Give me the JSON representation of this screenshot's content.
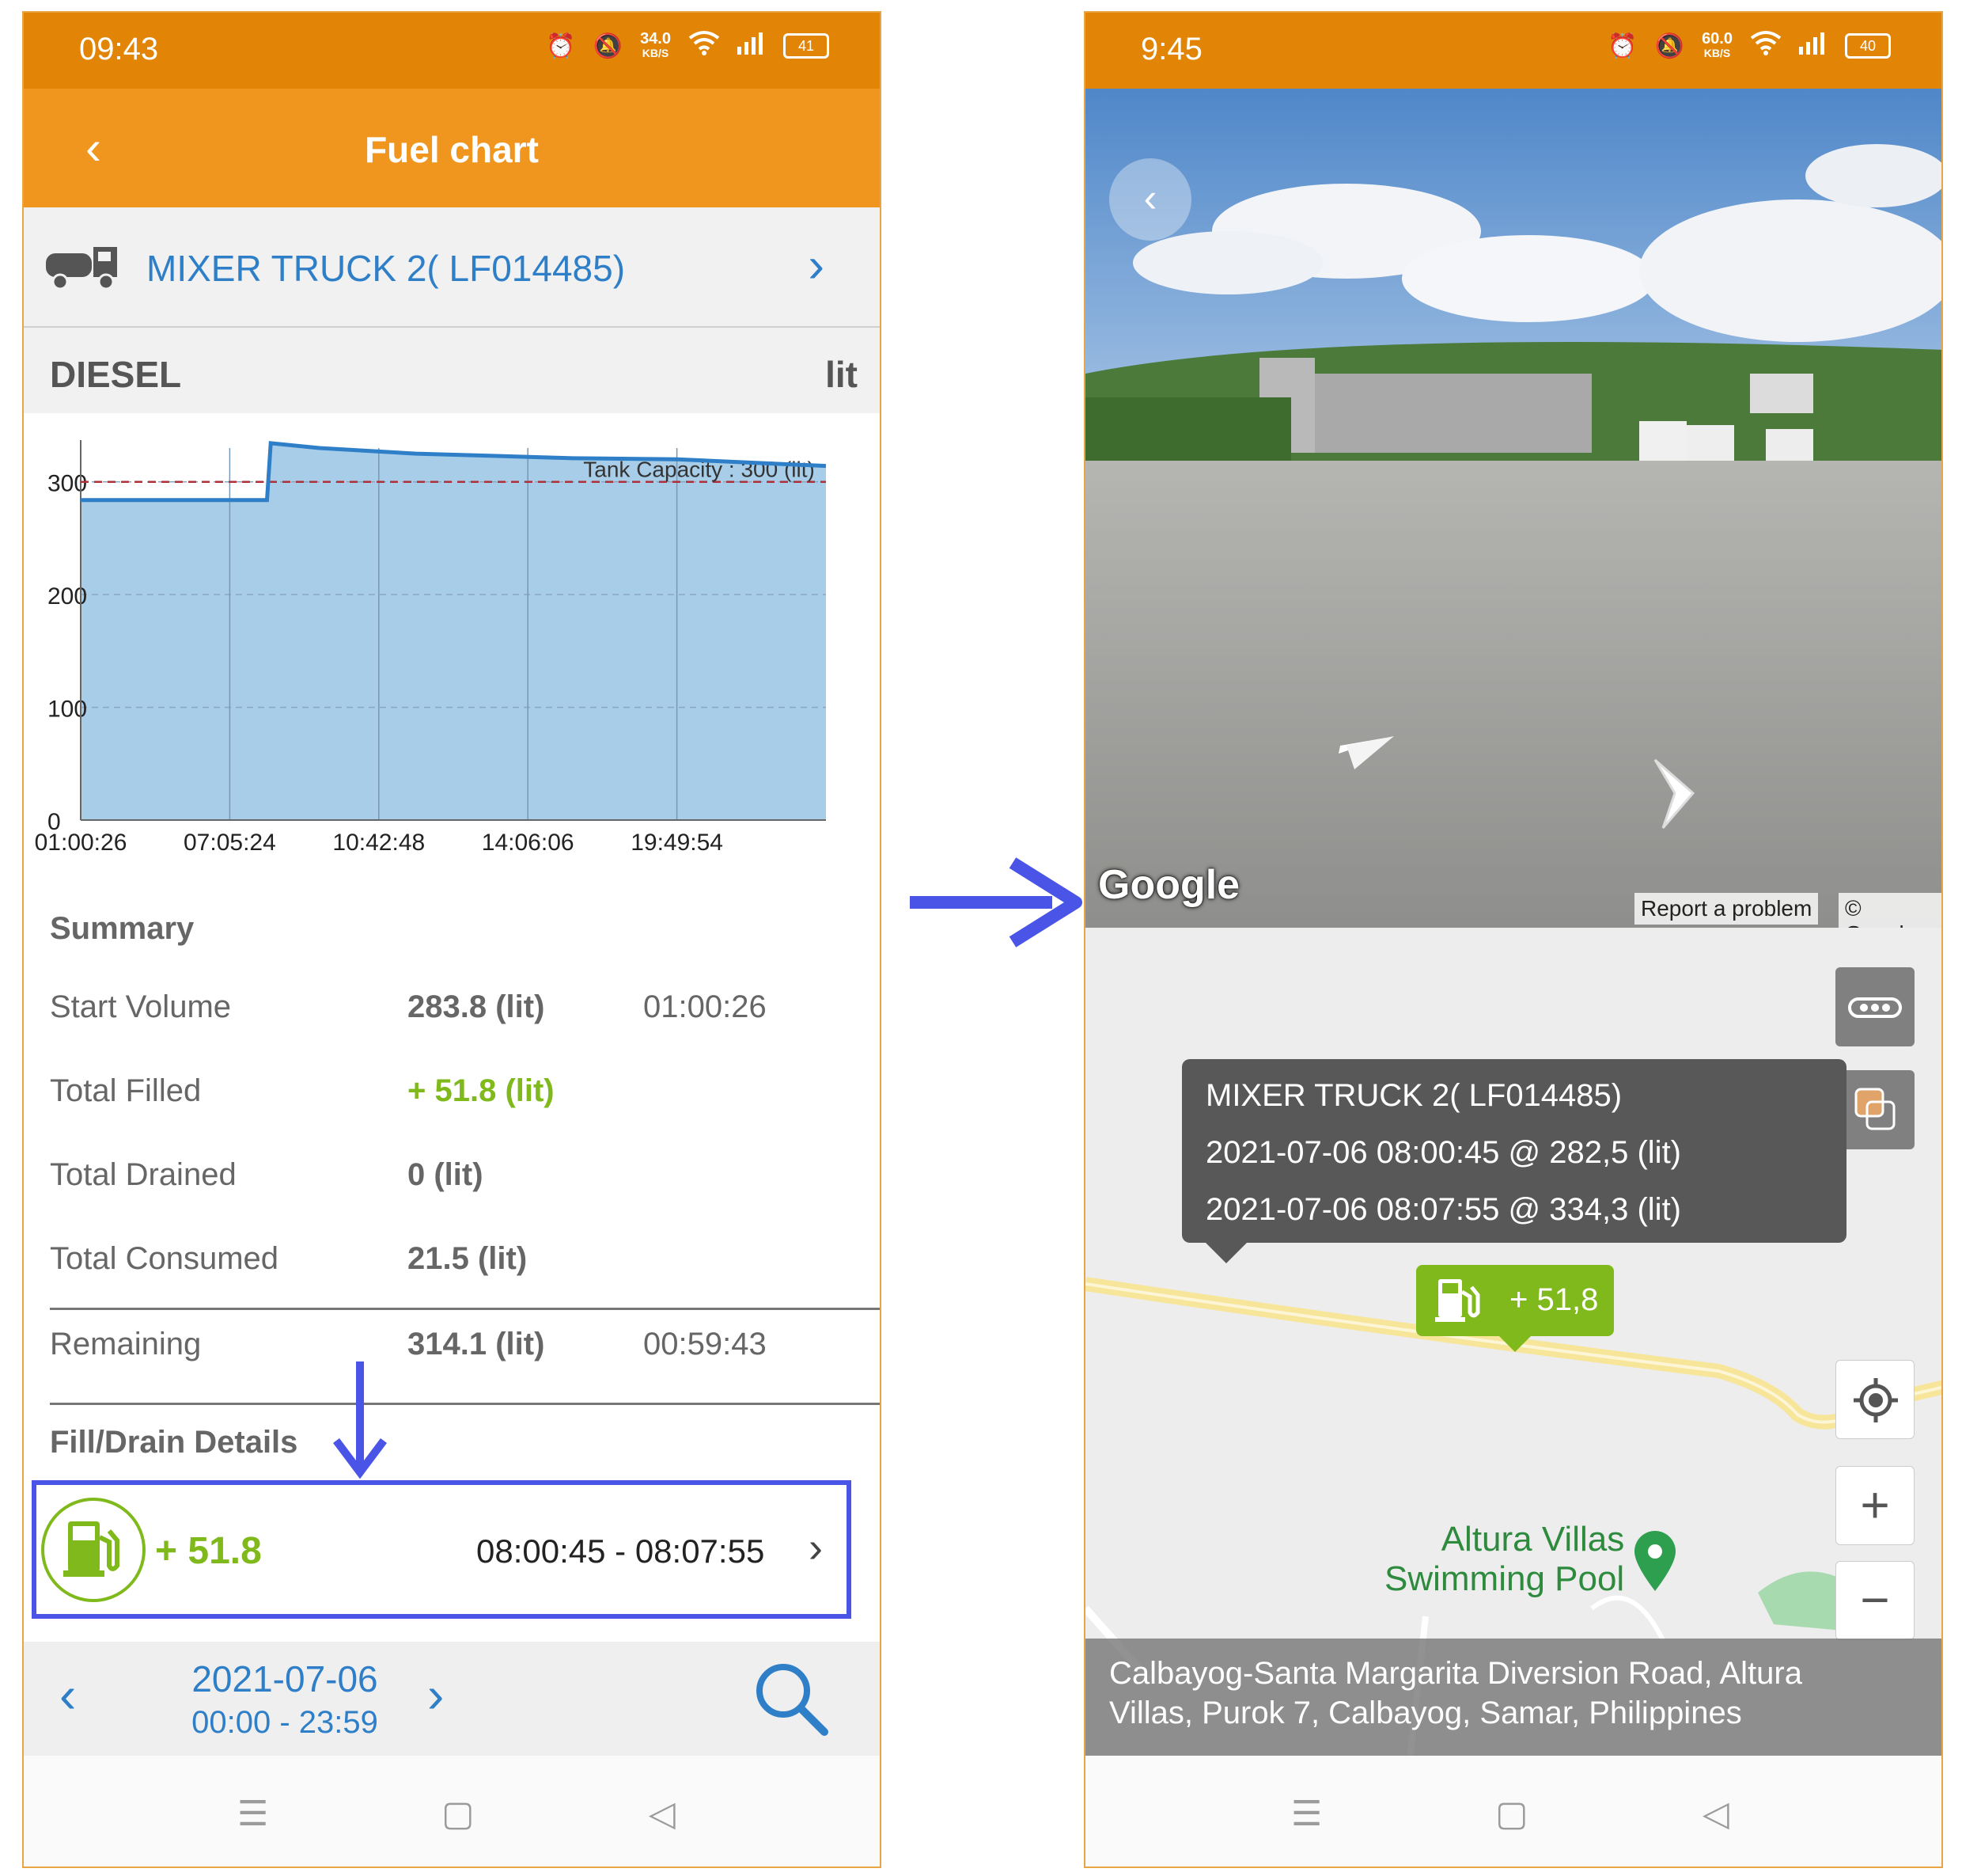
{
  "left_screen": {
    "status": {
      "time": "09:43",
      "net_speed": "34.0",
      "net_unit": "KB/S",
      "battery": "41"
    },
    "header": {
      "title": "Fuel chart"
    },
    "vehicle": {
      "name": "MIXER TRUCK 2( LF014485)"
    },
    "fuel": {
      "type": "DIESEL",
      "unit": "lit"
    },
    "summary": {
      "heading": "Summary",
      "rows": [
        {
          "label": "Start Volume",
          "value": "283.8 (lit)",
          "time": "01:00:26"
        },
        {
          "label": "Total Filled",
          "value": "+ 51.8 (lit)",
          "time": ""
        },
        {
          "label": "Total Drained",
          "value": "0 (lit)",
          "time": ""
        },
        {
          "label": "Total Consumed",
          "value": "21.5 (lit)",
          "time": ""
        },
        {
          "label": "Remaining",
          "value": "314.1 (lit)",
          "time": "00:59:43"
        }
      ]
    },
    "fill_drain": {
      "heading": "Fill/Drain Details",
      "item": {
        "amount": "+ 51.8",
        "range": "08:00:45 - 08:07:55",
        "icon": "fuel-pump-icon"
      }
    },
    "date_bar": {
      "date": "2021-07-06",
      "range": "00:00 - 23:59"
    }
  },
  "chart_data": {
    "type": "area",
    "title": "",
    "xlabel": "",
    "ylabel": "",
    "x_ticks": [
      "01:00:26",
      "07:05:24",
      "10:42:48",
      "14:06:06",
      "19:49:54"
    ],
    "y_ticks": [
      0,
      100,
      200,
      300
    ],
    "ylim": [
      0,
      330
    ],
    "annotation": "Tank Capacity : 300 (lit)",
    "threshold": 300,
    "series": [
      {
        "values": [
          [
            0.0,
            283.8
          ],
          [
            0.25,
            283.8
          ],
          [
            0.255,
            334.3
          ],
          [
            0.32,
            330
          ],
          [
            0.45,
            325
          ],
          [
            0.66,
            321
          ],
          [
            0.8,
            320
          ],
          [
            1.0,
            314.1
          ]
        ]
      }
    ],
    "fill_color": "#a8cde9",
    "line_color": "#2f7fc8",
    "grid": true
  },
  "right_screen": {
    "status": {
      "time": "9:45",
      "net_speed": "60.0",
      "net_unit": "KB/S",
      "battery": "40"
    },
    "street_view": {
      "logo": "Google",
      "report": "Report a problem",
      "copyright": "© Google"
    },
    "tooltip": {
      "line1": "MIXER TRUCK 2( LF014485)",
      "line2": "2021-07-06 08:00:45 @ 282,5 (lit)",
      "line3": "2021-07-06 08:07:55 @ 334,3 (lit)"
    },
    "marker": {
      "label": "+ 51,8"
    },
    "poi": {
      "line1": "Altura Villas",
      "line2": "Swimming Pool"
    },
    "address": {
      "line1": "Calbayog-Santa Margarita Diversion Road, Altura",
      "line2": "Villas, Purok 7, Calbayog, Samar, Philippines"
    },
    "map_controls": {
      "zoom_in": "+",
      "zoom_out": "−"
    }
  }
}
